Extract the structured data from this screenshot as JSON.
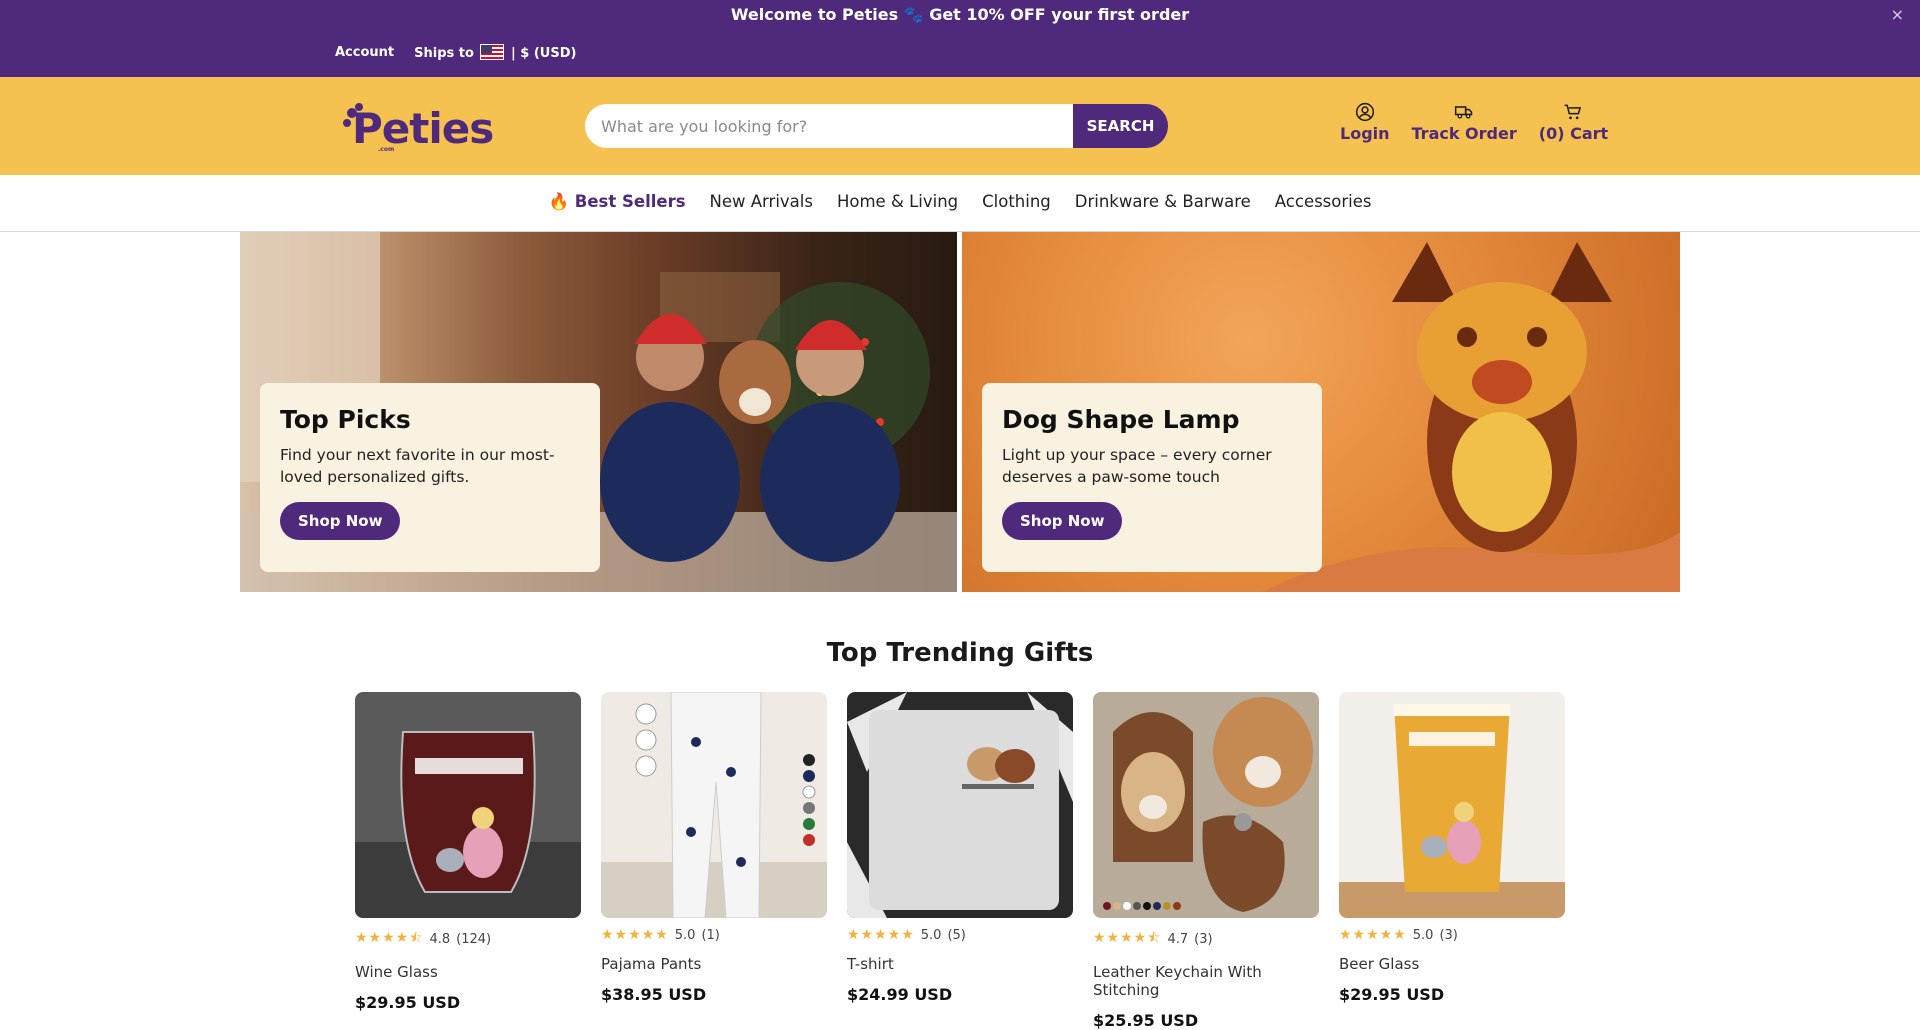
{
  "colors": {
    "brand_purple": "#4f2a7c",
    "header_yellow": "#f5c150",
    "card_cream": "#faf2e1",
    "star_gold": "#f2b33d"
  },
  "announcement": {
    "message": "Welcome to Peties 🐾 Get 10% OFF your first order",
    "close_icon": "×",
    "account_label": "Account",
    "ships_to_label": "Ships to",
    "currency_label": "| $ (USD)"
  },
  "header": {
    "logo_text": "Peties",
    "logo_suffix": ".com",
    "search": {
      "placeholder": "What are you looking for?",
      "button_label": "SEARCH"
    },
    "actions": [
      {
        "label": "Login",
        "icon": "user-circle-icon"
      },
      {
        "label": "Track Order",
        "icon": "truck-icon"
      },
      {
        "label": "(0) Cart",
        "icon": "cart-icon"
      }
    ]
  },
  "nav": {
    "items": [
      {
        "label": "🔥 Best Sellers",
        "active": true
      },
      {
        "label": "New Arrivals"
      },
      {
        "label": "Home & Living"
      },
      {
        "label": "Clothing"
      },
      {
        "label": "Drinkware & Barware"
      },
      {
        "label": "Accessories"
      }
    ]
  },
  "hero": [
    {
      "title": "Top Picks",
      "text": "Find your next favorite in our most-loved personalized gifts.",
      "button": "Shop Now"
    },
    {
      "title": "Dog Shape Lamp",
      "text": "Light up your space – every corner deserves a paw-some touch",
      "button": "Shop Now"
    }
  ],
  "trending": {
    "title": "Top Trending Gifts",
    "products": [
      {
        "name": "Wine Glass",
        "rating": "4.8",
        "reviews": "(124)",
        "stars": "★★★★⯪",
        "price": "$29.95 USD"
      },
      {
        "name": "Pajama Pants",
        "rating": "5.0",
        "reviews": "(1)",
        "stars": "★★★★★",
        "price": "$38.95 USD"
      },
      {
        "name": "T-shirt",
        "rating": "5.0",
        "reviews": "(5)",
        "stars": "★★★★★",
        "price": "$24.99 USD"
      },
      {
        "name": "Leather Keychain With Stitching",
        "rating": "4.7",
        "reviews": "(3)",
        "stars": "★★★★⯪",
        "price": "$25.95 USD"
      },
      {
        "name": "Beer Glass",
        "rating": "5.0",
        "reviews": "(3)",
        "stars": "★★★★★",
        "price": "$29.95 USD"
      }
    ]
  }
}
